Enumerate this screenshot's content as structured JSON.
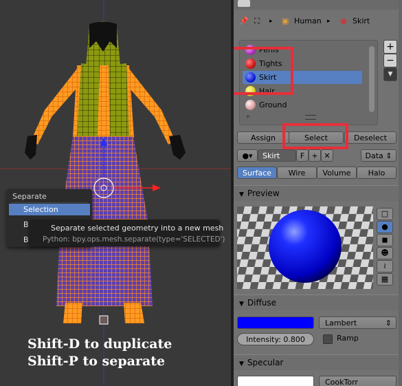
{
  "captions": {
    "line1": "Shift-D to duplicate",
    "line2": "Shift-P to separate"
  },
  "menu": {
    "title": "Separate",
    "items": [
      {
        "label": "Selection",
        "selected": true
      },
      {
        "label": "By Material",
        "selected": false
      },
      {
        "label": "By loose parts",
        "selected": false
      }
    ]
  },
  "tooltip": {
    "text": "Separate selected geometry into a new mesh",
    "python": "Python: bpy.ops.mesh.separate(type='SELECTED')"
  },
  "breadcrumb": {
    "object": "Human",
    "material": "Skirt"
  },
  "materials": [
    {
      "name": "Penis",
      "color": "#b030c0",
      "selected": false
    },
    {
      "name": "Tights",
      "color": "#d01818",
      "selected": false
    },
    {
      "name": "Skirt",
      "color": "#1020d8",
      "selected": true
    },
    {
      "name": "Hair",
      "color": "#d8d020",
      "selected": false
    },
    {
      "name": "Ground",
      "color": "#d8a0a0",
      "selected": false
    }
  ],
  "list_buttons": {
    "add": "+",
    "remove": "−"
  },
  "actions": {
    "assign": "Assign",
    "select": "Select",
    "deselect": "Deselect"
  },
  "material_slot": {
    "name": "Skirt",
    "fake_user": "F",
    "add": "+",
    "remove": "✕",
    "link": "Data"
  },
  "tabs": [
    {
      "label": "Surface",
      "active": true
    },
    {
      "label": "Wire",
      "active": false
    },
    {
      "label": "Volume",
      "active": false
    },
    {
      "label": "Halo",
      "active": false
    }
  ],
  "preview": {
    "title": "Preview"
  },
  "diffuse": {
    "title": "Diffuse",
    "color": "#0000ff",
    "shader": "Lambert",
    "intensity": "Intensity: 0.800",
    "ramp_label": "Ramp"
  },
  "specular": {
    "title": "Specular",
    "color": "#ffffff",
    "shader": "CookTorr"
  },
  "colors": {
    "accent": "#5680c2",
    "highlight_box": "#e52f3a",
    "wire": "#ff8c1a"
  }
}
